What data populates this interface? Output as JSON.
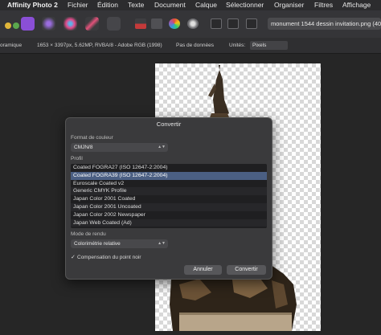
{
  "menubar": {
    "app_name": "Affinity Photo 2",
    "items": [
      "Fichier",
      "Édition",
      "Texte",
      "Document",
      "Calque",
      "Sélectionner",
      "Organiser",
      "Filtres",
      "Affichage"
    ]
  },
  "toolbar": {
    "document_title": "monument 1544 dessin invitation.png (40.61"
  },
  "contextbar": {
    "mode_label": "oramique",
    "image_info": "1653 × 3397px, 5.62MP, RVBA/8 - Adobe RGB (1998)",
    "metadata_label": "Pas de données",
    "units_label": "Unités:",
    "units_value": "Pixels"
  },
  "dialog": {
    "title": "Convertir",
    "color_format_label": "Format de couleur",
    "color_format_value": "CMJN/8",
    "profile_label": "Profil",
    "profiles": [
      "Coated FOGRA27 (ISO 12647-2:2004)",
      "Coated FOGRA39 (ISO 12647-2:2004)",
      "Euroscale Coated v2",
      "Generic CMYK Profile",
      "Japan Color 2001 Coated",
      "Japan Color 2001 Uncoated",
      "Japan Color 2002 Newspaper",
      "Japan Web Coated (Ad)"
    ],
    "selected_profile_index": 1,
    "rendering_intent_label": "Mode de rendu",
    "rendering_intent_value": "Colorimétrie relative",
    "black_point_label": "Compensation du point noir",
    "black_point_checked": true,
    "cancel_label": "Annuler",
    "convert_label": "Convertir"
  },
  "colors": {
    "selection": "#4b5f83",
    "dialog_bg": "#3a3a3c",
    "persona_accent": "#8a4fd6"
  }
}
